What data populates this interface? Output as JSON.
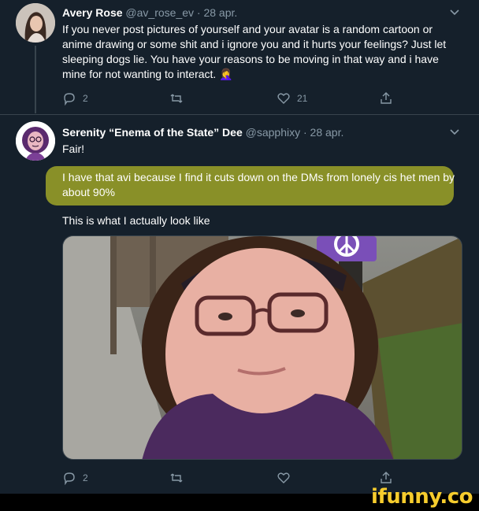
{
  "tweet1": {
    "name": "Avery Rose",
    "handle": "@av_rose_ev",
    "date": "· 28 apr.",
    "text": "If you never post pictures of yourself and your avatar is a random cartoon or anime drawing or some shit and i ignore you and it hurts your feelings? Just let sleeping dogs lie. You have your reasons to be moving in that way and i have mine for not wanting to interact. 🤦‍♀️",
    "reply_count": "2",
    "retweet_count": "",
    "like_count": "21"
  },
  "tweet2": {
    "name": "Serenity “Enema of the State” Dee",
    "handle": "@sapphixy",
    "date": "· 28 apr.",
    "line1": "Fair!",
    "highlighted": "I have that avi because I find it cuts down on the DMs from lonely cis het men by about 90%",
    "line3": "This is what I actually look like",
    "reply_count": "2",
    "retweet_count": "",
    "like_count": ""
  },
  "watermark": "ifunny.co",
  "icons": [
    "reply-icon",
    "retweet-icon",
    "like-icon",
    "share-icon",
    "chevron-down-icon",
    "peace-icon"
  ],
  "colors": {
    "background": "#15202b",
    "secondary_text": "#8899a6",
    "highlight": "#aaaf28",
    "watermark": "#f6cc2d"
  }
}
